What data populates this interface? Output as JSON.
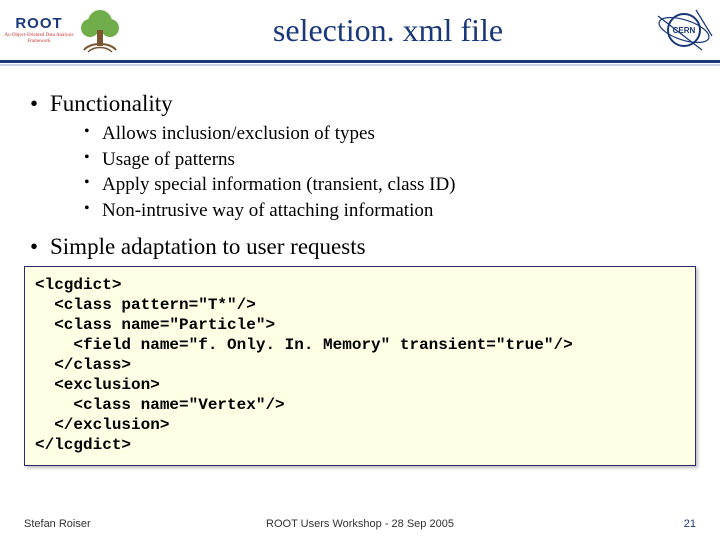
{
  "header": {
    "root_word": "ROOT",
    "root_sub": "An Object-Oriented\nData Analysis Framework",
    "title": "selection. xml file",
    "cern_label": "CERN"
  },
  "bullets": {
    "top1": "Functionality",
    "sub": [
      "Allows inclusion/exclusion of types",
      "Usage of patterns",
      "Apply special information (transient, class ID)",
      "Non-intrusive way of attaching information"
    ],
    "top2": "Simple adaptation to user requests"
  },
  "code": "<lcgdict>\n  <class pattern=\"T*\"/>\n  <class name=\"Particle\">\n    <field name=\"f. Only. In. Memory\" transient=\"true\"/>\n  </class>\n  <exclusion>\n    <class name=\"Vertex\"/>\n  </exclusion>\n</lcgdict>",
  "footer": {
    "left": "Stefan Roiser",
    "center": "ROOT Users Workshop  -  28 Sep 2005",
    "right": "21"
  },
  "colors": {
    "accent": "#18387a",
    "code_bg": "#ffffe6"
  }
}
